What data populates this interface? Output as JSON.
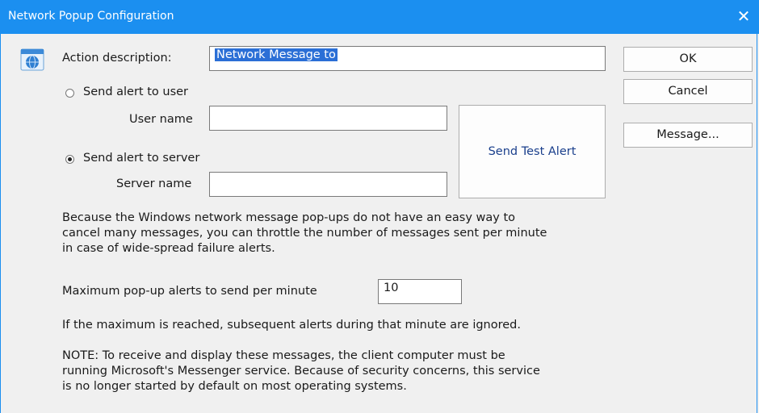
{
  "window": {
    "title": "Network Popup Configuration",
    "close_glyph": "✕"
  },
  "action": {
    "label": "Action description:",
    "value": "Network Message to",
    "icon": "network-window-icon"
  },
  "user_option": {
    "label": "Send alert to user",
    "selected": false,
    "name_label": "User name",
    "name_value": ""
  },
  "server_option": {
    "label": "Send alert to server",
    "selected": true,
    "name_label": "Server name",
    "name_value": ""
  },
  "buttons": {
    "ok": "OK",
    "cancel": "Cancel",
    "message": "Message...",
    "test": "Send Test Alert"
  },
  "throttle_note": [
    "Because the Windows network message pop-ups do not have an easy way to",
    "cancel many messages, you can throttle the number of messages sent per minute",
    "in case of wide-spread failure alerts."
  ],
  "max_alerts": {
    "label": "Maximum pop-up alerts to send per minute",
    "value": "10"
  },
  "ignored_note": "If the maximum is reached, subsequent alerts during that minute are ignored.",
  "messenger_note": [
    "NOTE: To receive and display these messages, the client computer must be",
    "running Microsoft's Messenger service.  Because of security concerns, this service",
    "is no longer started by default on most operating systems."
  ],
  "colors": {
    "titlebar": "#1b8ff0",
    "selection": "#2b6fd6",
    "link_text": "#1a3f8c"
  }
}
